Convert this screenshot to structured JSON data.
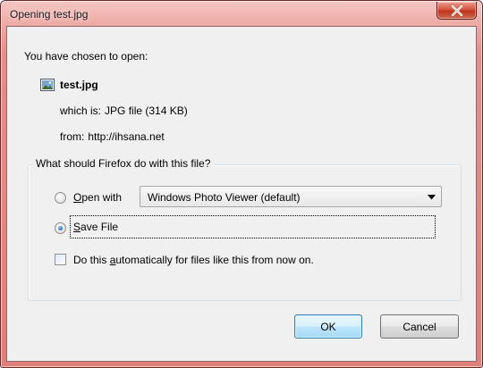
{
  "window": {
    "title": "Opening test.jpg",
    "close_icon": "close-x-icon"
  },
  "dialog": {
    "intro": "You have chosen to open:",
    "file_name": "test.jpg",
    "file_icon": "image-file-icon",
    "which_is_label": "which is:",
    "which_is_value": "JPG file (314 KB)",
    "from_label": "from:",
    "from_value": "http://ihsana.net"
  },
  "action_group": {
    "legend": "What should Firefox do with this file?",
    "open_with": {
      "accel": "O",
      "rest": "pen with",
      "selected": false
    },
    "app_select": {
      "value": "Windows Photo Viewer (default)"
    },
    "save_file": {
      "accel": "S",
      "rest": "ave File",
      "selected": true
    },
    "auto_checkbox": {
      "pre": "Do this ",
      "accel": "a",
      "rest": "utomatically for files like this from now on.",
      "checked": false
    }
  },
  "buttons": {
    "ok": "OK",
    "cancel": "Cancel"
  },
  "colors": {
    "frame": "#e68e88",
    "client": "#f0f0f0",
    "close_button": "#c0331f"
  }
}
